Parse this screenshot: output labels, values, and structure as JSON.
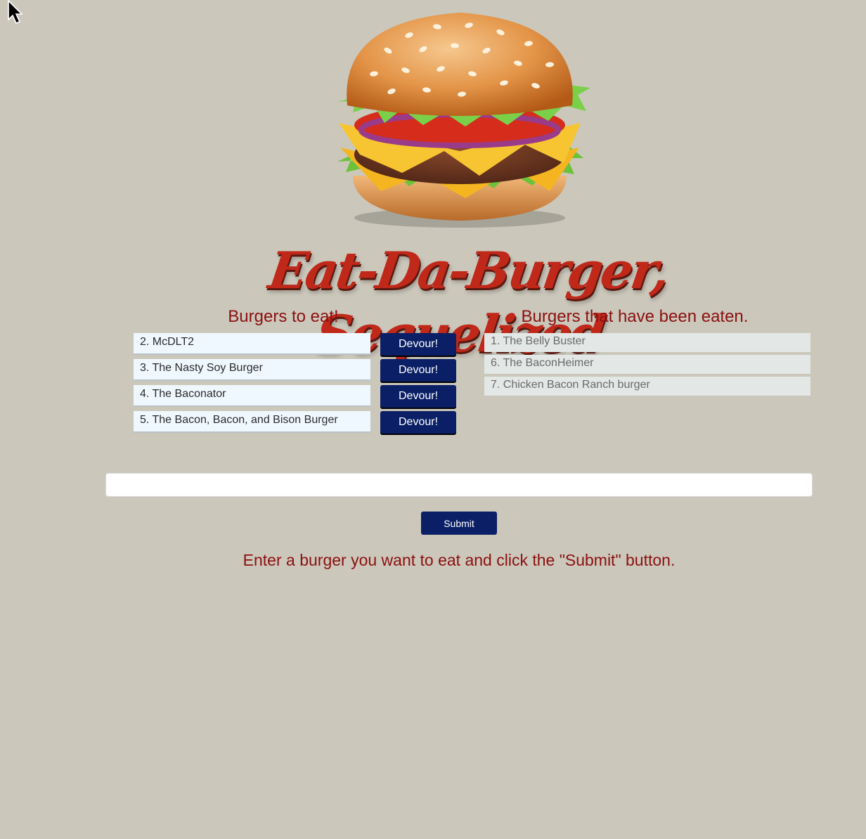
{
  "header": {
    "title": "Eat-Da-Burger, Sequelized",
    "hero_icon": "burger-illustration"
  },
  "to_eat": {
    "heading": "Burgers to eat!",
    "items": [
      {
        "label": "2. McDLT2",
        "button": "Devour!"
      },
      {
        "label": "3. The Nasty Soy Burger",
        "button": "Devour!"
      },
      {
        "label": "4. The Baconator",
        "button": "Devour!"
      },
      {
        "label": "5. The Bacon, Bacon, and Bison Burger",
        "button": "Devour!"
      }
    ]
  },
  "eaten": {
    "heading": "Burgers that have been eaten.",
    "items": [
      {
        "label": "1. The Belly Buster"
      },
      {
        "label": "6. The BaconHeimer"
      },
      {
        "label": "7. Chicken Bacon Ranch burger"
      }
    ]
  },
  "form": {
    "input_value": "",
    "submit_label": "Submit",
    "instruction": "Enter a burger you want to eat and click the \"Submit\" button."
  },
  "colors": {
    "background": "#cbc7bb",
    "accent_red": "#8c1010",
    "button_navy": "#0a1f66"
  }
}
